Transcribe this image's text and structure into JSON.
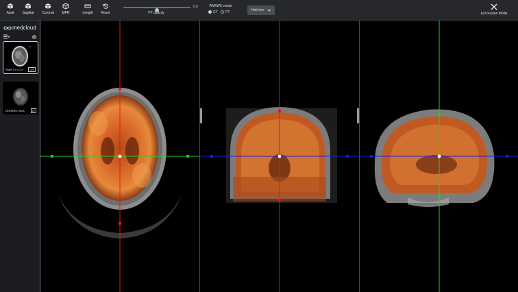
{
  "toolbar": {
    "tools": [
      {
        "label": "Axial",
        "icon": "cube-axial-icon"
      },
      {
        "label": "Sagittal",
        "icon": "cube-sagittal-icon"
      },
      {
        "label": "Coronal",
        "icon": "cube-coronal-icon"
      },
      {
        "label": "MPR",
        "icon": "cube-mpr-icon"
      },
      {
        "label": "Length",
        "icon": "ruler-icon"
      },
      {
        "label": "Reset",
        "icon": "reset-icon"
      }
    ],
    "pt_opacity": {
      "label": "PT opacity",
      "value": "0.5",
      "level": 0.5
    },
    "wwwc": {
      "title": "WW/WC mode",
      "options": [
        "CT",
        "PT"
      ],
      "selected": "CT"
    },
    "lut": {
      "selected": "Hot Iron"
    },
    "exit": {
      "label": "Exit Fusion Mode",
      "icon": "close-icon"
    }
  },
  "sidebar": {
    "brand": "medcloud",
    "series": [
      {
        "label": "Brain 5.0 x 2.5",
        "count": "321",
        "selected": true
      },
      {
        "label": "CEREBRO MAC",
        "count": "47",
        "selected": false
      }
    ]
  },
  "viewports": [
    {
      "name": "axial"
    },
    {
      "name": "coronal"
    },
    {
      "name": "sagittal"
    }
  ],
  "colors": {
    "toolbar_bg": "#26282c",
    "sidebar_bg": "#1b1d21",
    "crosshair_red": "#e8141c",
    "crosshair_green": "#26d126",
    "crosshair_blue": "#1f1fe6",
    "pet_hot": "#e85a20"
  }
}
